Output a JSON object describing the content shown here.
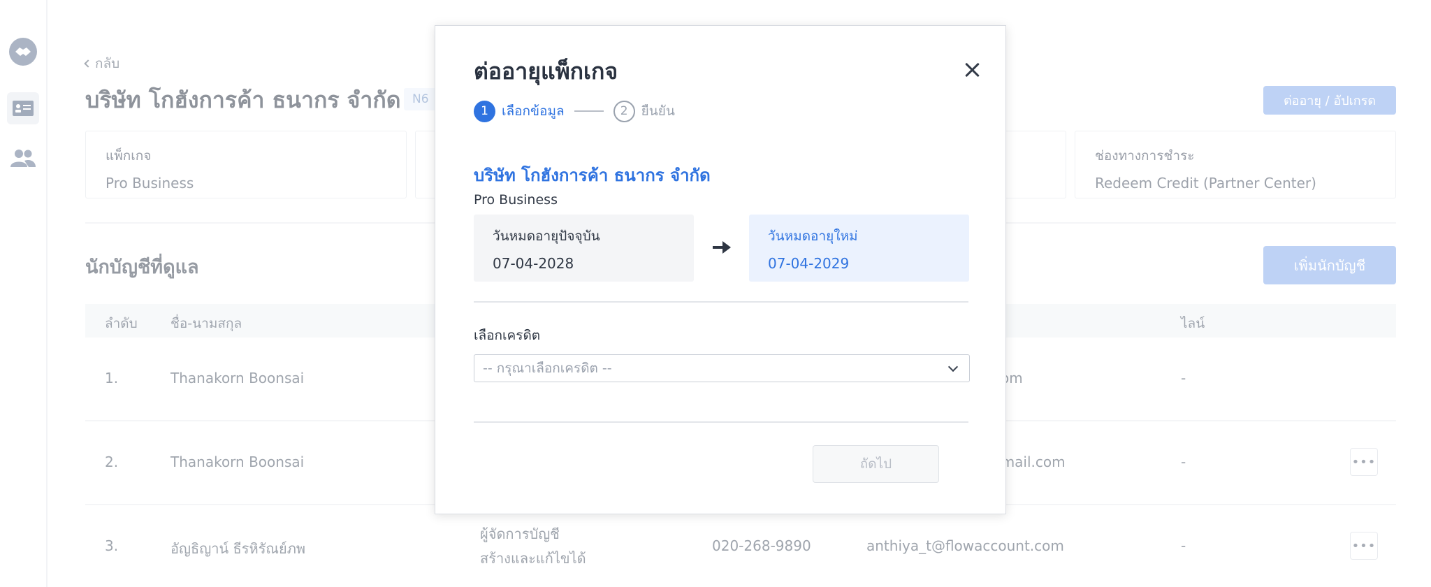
{
  "background": {
    "back_label": "กลับ",
    "company_title": "บริษัท โกฮังการค้า ธนากร จำกัด",
    "company_code": "N6",
    "renew_button": "ต่ออายุ / อัปเกรด",
    "cards": [
      {
        "label": "แพ็กเกจ",
        "value": "Pro Business"
      },
      {
        "label": "",
        "value": ""
      },
      {
        "label": "",
        "value": ""
      },
      {
        "label": "ช่องทางการชำระ",
        "value": "Redeem Credit (Partner Center)"
      }
    ],
    "section_title": "นักบัญชีที่ดูแล",
    "add_button": "เพิ่มนักบัญชี",
    "table": {
      "headers": {
        "order": "ลำดับ",
        "name": "ชื่อ-นามสกุล",
        "line": "ไลน์"
      },
      "rows": [
        {
          "no": "1.",
          "name": "Thanakorn Boonsai",
          "role": "",
          "perm": "",
          "phone": "",
          "email": "om",
          "line": "-"
        },
        {
          "no": "2.",
          "name": "Thanakorn Boonsai",
          "role": "",
          "perm": "",
          "phone": "",
          "email": "gmail.com",
          "line": "-"
        },
        {
          "no": "3.",
          "name": "อัญธิญาน์ ธีรหิรัณย์ภพ",
          "role": "ผู้จัดการบัญชี",
          "perm": "สร้างและแก้ไขได้",
          "phone": "020-268-9890",
          "email": "anthiya_t@flowaccount.com",
          "line": "-"
        }
      ]
    }
  },
  "modal": {
    "title": "ต่ออายุแพ็กเกจ",
    "steps": [
      {
        "num": "1",
        "label": "เลือกข้อมูล"
      },
      {
        "num": "2",
        "label": "ยืนยัน"
      }
    ],
    "company_name": "บริษัท โกฮังการค้า ธนากร จำกัด",
    "package_name": "Pro Business",
    "current_expiry": {
      "label": "วันหมดอายุปัจจุบัน",
      "value": "07-04-2028"
    },
    "new_expiry": {
      "label": "วันหมดอายุใหม่",
      "value": "07-04-2029"
    },
    "credit_label": "เลือกเครดิต",
    "credit_placeholder": "-- กรุณาเลือกเครดิต --",
    "next_button": "ถัดไป"
  },
  "colors": {
    "accent": "#2f73e0",
    "button_disabled_bg": "#8fb2ee",
    "new_expiry_bg": "#ebf2fe"
  },
  "icons": {
    "rail": [
      "handshake-icon",
      "contact-card-icon",
      "users-icon"
    ],
    "modal": [
      "close-icon",
      "arrow-right-icon",
      "chevron-down-icon"
    ]
  }
}
